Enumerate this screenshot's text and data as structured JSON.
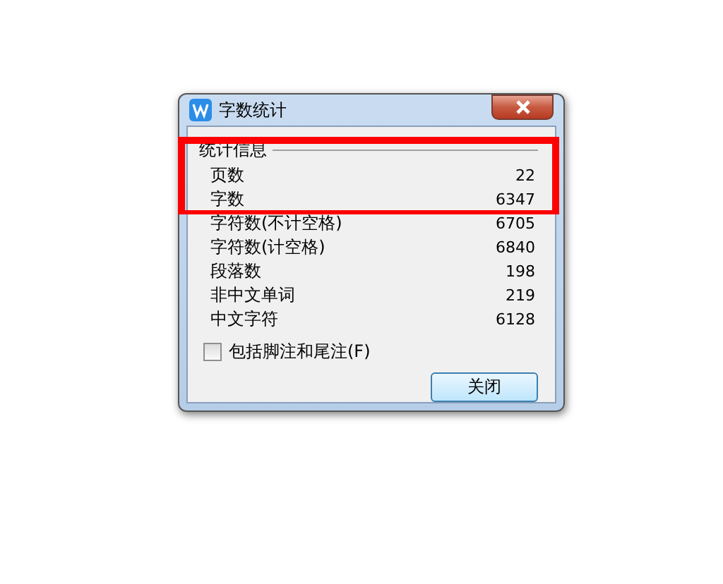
{
  "window": {
    "title": "字数统计"
  },
  "group": {
    "title": "统计信息"
  },
  "stats": [
    {
      "label": "页数",
      "value": "22"
    },
    {
      "label": "字数",
      "value": "6347"
    },
    {
      "label": "字符数(不计空格)",
      "value": "6705"
    },
    {
      "label": "字符数(计空格)",
      "value": "6840"
    },
    {
      "label": "段落数",
      "value": "198"
    },
    {
      "label": "非中文单词",
      "value": "219"
    },
    {
      "label": "中文字符",
      "value": "6128"
    }
  ],
  "checkbox": {
    "label": "包括脚注和尾注(F)",
    "checked": false
  },
  "buttons": [
    "关闭"
  ]
}
